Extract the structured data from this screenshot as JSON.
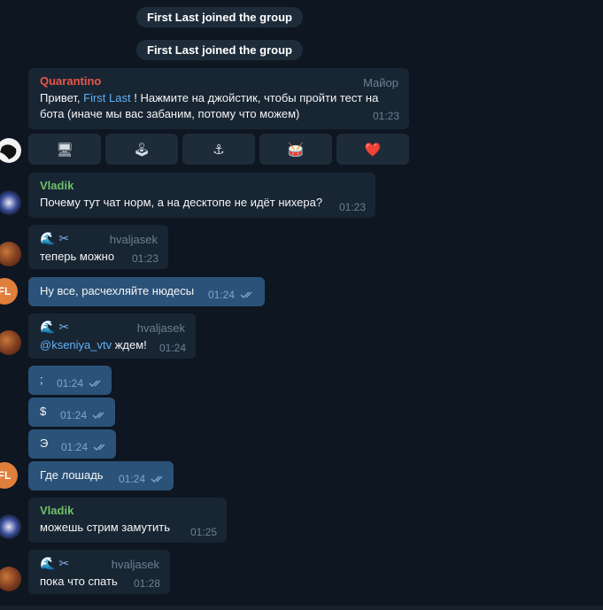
{
  "service": [
    {
      "text": "First Last joined the group"
    },
    {
      "text": "First Last joined the group"
    }
  ],
  "quarantino": {
    "sender": "Quarantino",
    "role": "Майор",
    "line1_pre": "Привет, ",
    "mention": "First Last",
    "line1_post": " ! Нажмите на джойстик, чтобы пройти тест на",
    "line2": "бота (иначе мы вас забаним, потому что можем)",
    "time": "01:23"
  },
  "keyboard": [
    {
      "icon": "🖥",
      "icon_name": "monitor-icon"
    },
    {
      "icon": "🕹",
      "icon_name": "joystick-icon"
    },
    {
      "icon": "⚓",
      "icon_name": "anchor-icon"
    },
    {
      "icon": "🥁",
      "icon_name": "drum-icon"
    },
    {
      "icon": "❤️",
      "icon_name": "heart-icon"
    }
  ],
  "messages": {
    "m1": {
      "sender": "Vladik",
      "text": "Почему тут чат норм, а на десктопе не идёт нихера?",
      "time": "01:23"
    },
    "m2": {
      "sender": "🌊 ✂",
      "username": "hvaljasek",
      "text": "теперь можно",
      "time": "01:23"
    },
    "m3": {
      "text": "Ну все, расчехляйте нюдесы",
      "time": "01:24"
    },
    "m4": {
      "sender": "🌊 ✂",
      "username": "hvaljasek",
      "mention": "@kseniya_vtv",
      "text": " ждем!",
      "time": "01:24"
    },
    "m5": {
      "text": ";",
      "time": "01:24"
    },
    "m6": {
      "text": "$",
      "time": "01:24"
    },
    "m7": {
      "text": "Э",
      "time": "01:24"
    },
    "m8": {
      "text": "Где лошадь",
      "time": "01:24"
    },
    "m9": {
      "sender": "Vladik",
      "text": "можешь стрим замутить",
      "time": "01:25"
    },
    "m10": {
      "sender": "🌊 ✂",
      "username": "hvaljasek",
      "text": "пока что спать",
      "time": "01:28"
    }
  },
  "avatar_initials": "FL",
  "colors": {
    "background": "#0e1621",
    "incoming": "#182533",
    "outgoing": "#2b5278",
    "accent_link": "#62b1f6",
    "quarantino_name": "#e9564c",
    "vladik_name": "#6fc06a"
  }
}
